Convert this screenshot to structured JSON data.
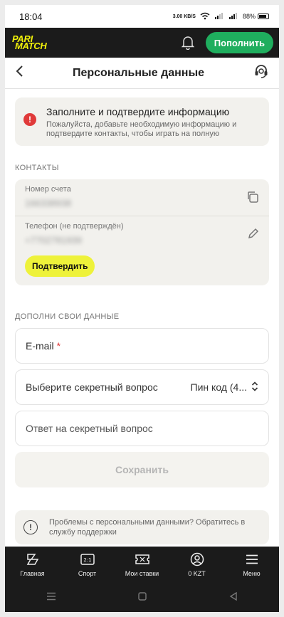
{
  "status": {
    "time": "18:04",
    "speed": "3.00 KB/S",
    "battery": "88%"
  },
  "app": {
    "logo_line1": "PARI",
    "logo_line2": "MATCH",
    "deposit_label": "Пополнить"
  },
  "page": {
    "title": "Персональные данные"
  },
  "alert": {
    "title": "Заполните и подтвердите информацию",
    "text": "Пожалуйста, добавьте необходимую информацию и подтвердите контакты, чтобы играть на полную"
  },
  "contacts": {
    "section_label": "КОНТАКТЫ",
    "account_label": "Номер счета",
    "account_value": "166338938",
    "phone_label": "Телефон (не подтверждён)",
    "phone_value": "+7702781939",
    "verify_label": "Подтвердить"
  },
  "form": {
    "section_label": "ДОПОЛНИ СВОИ ДАННЫЕ",
    "email_label": "E-mail",
    "email_required": "*",
    "secret_question_label": "Выберите секретный вопрос",
    "secret_question_value": "Пин код (4...",
    "secret_answer_placeholder": "Ответ на секретный вопрос",
    "save_label": "Сохранить"
  },
  "support": {
    "text": "Проблемы с персональными данными? Обратитесь в службу поддержки"
  },
  "nav": {
    "items": [
      {
        "label": "Главная",
        "icon": "home-icon"
      },
      {
        "label": "Спорт",
        "icon": "scoreboard-icon"
      },
      {
        "label": "Мои ставки",
        "icon": "ticket-icon"
      },
      {
        "label": "0 KZT",
        "icon": "account-icon"
      },
      {
        "label": "Меню",
        "icon": "menu-icon"
      }
    ]
  },
  "colors": {
    "accent_green": "#1fae5e",
    "brand_yellow": "#f2f20a",
    "verify_yellow": "#eef23a",
    "alert_red": "#e03a3a",
    "dark_bar": "#1b1b1b"
  }
}
